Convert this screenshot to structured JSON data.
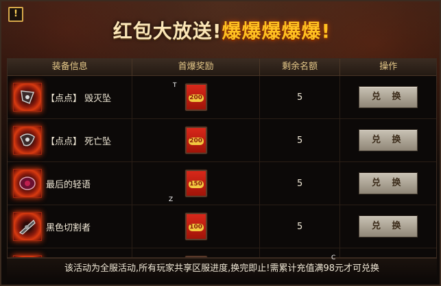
{
  "header": {
    "info_icon": "exclamation-icon",
    "title_part1": "红包大放送!",
    "title_part2": "爆爆爆爆爆!"
  },
  "table": {
    "columns": [
      "装备信息",
      "首爆奖励",
      "剩余名额",
      "操作"
    ],
    "rows": [
      {
        "item": "【点点】 毁灭坠",
        "reward": "200",
        "remaining": "5",
        "action": "兑 换"
      },
      {
        "item": "【点点】 死亡坠",
        "reward": "200",
        "remaining": "5",
        "action": "兑 换"
      },
      {
        "item": "最后的轻语",
        "reward": "150",
        "remaining": "5",
        "action": "兑 换"
      },
      {
        "item": "黑色切割者",
        "reward": "100",
        "remaining": "5",
        "action": "兑 换"
      },
      {
        "item": "",
        "reward": "",
        "remaining": "",
        "action": ""
      }
    ]
  },
  "footer": {
    "notice": "该活动为全服活动,所有玩家共享区服进度,换完即止!需累计充值满98元才可兑换"
  },
  "stray_marks": [
    "T",
    "Z",
    "C"
  ],
  "colors": {
    "accent_gold": "#ffc020",
    "packet_red": "#d8281a",
    "button_gray": "#c9c2b4"
  }
}
